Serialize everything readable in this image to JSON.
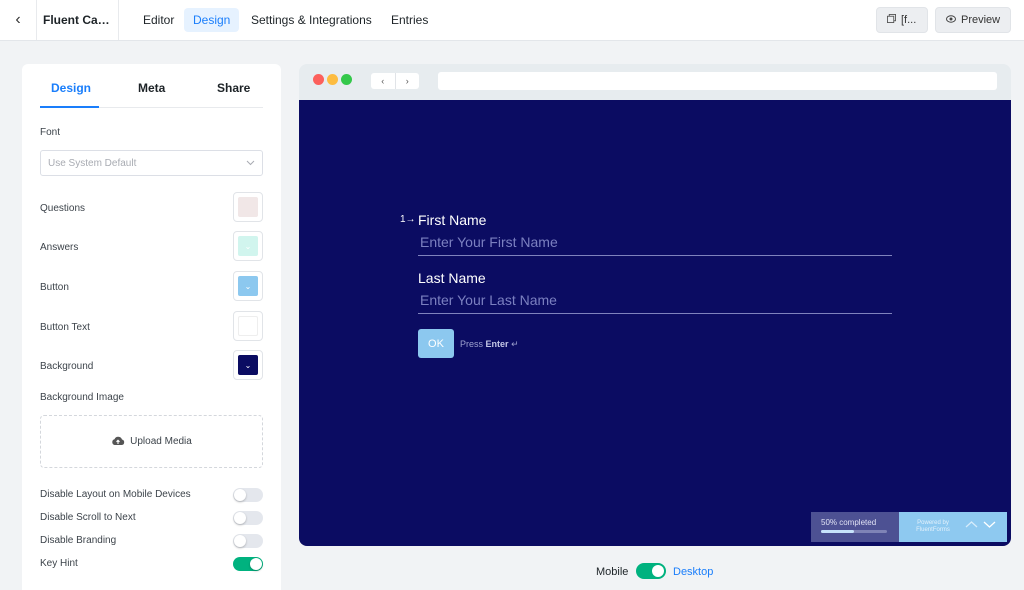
{
  "header": {
    "form_title": "Fluent Car...",
    "tabs": [
      {
        "label": "Editor"
      },
      {
        "label": "Design"
      },
      {
        "label": "Settings & Integrations"
      },
      {
        "label": "Entries"
      }
    ],
    "shortcode_label": "[f...",
    "preview_label": "Preview"
  },
  "sidebar": {
    "tabs": [
      {
        "label": "Design"
      },
      {
        "label": "Meta"
      },
      {
        "label": "Share"
      }
    ],
    "font_label": "Font",
    "font_placeholder": "Use System Default",
    "colors": [
      {
        "label": "Questions",
        "color": "#f1e7e7"
      },
      {
        "label": "Answers",
        "color": "#d1f5ee"
      },
      {
        "label": "Button",
        "color": "#8cc8ef"
      },
      {
        "label": "Button Text",
        "color": "#ffffff"
      },
      {
        "label": "Background",
        "color": "#0b0c62"
      }
    ],
    "background_image_label": "Background Image",
    "upload_label": "Upload Media",
    "toggles": [
      {
        "label": "Disable Layout on Mobile Devices",
        "on": false
      },
      {
        "label": "Disable Scroll to Next",
        "on": false
      },
      {
        "label": "Disable Branding",
        "on": false
      },
      {
        "label": "Key Hint",
        "on": true
      }
    ]
  },
  "preview": {
    "question_number": "1→",
    "questions": [
      {
        "label": "First Name",
        "placeholder": "Enter Your First Name"
      },
      {
        "label": "Last Name",
        "placeholder": "Enter Your Last Name"
      }
    ],
    "ok_label": "OK",
    "hint_prefix": "Press",
    "hint_key": "Enter",
    "hint_symbol": "↵",
    "progress_text": "50% completed",
    "progress_value": 0.5,
    "powered_line1": "Powered by",
    "powered_line2": "FluentForms"
  },
  "mode": {
    "mobile_label": "Mobile",
    "desktop_label": "Desktop"
  },
  "colors": {
    "accent": "#1a7efb",
    "toggle_on": "#00b27f",
    "form_background": "#0b0c62"
  }
}
